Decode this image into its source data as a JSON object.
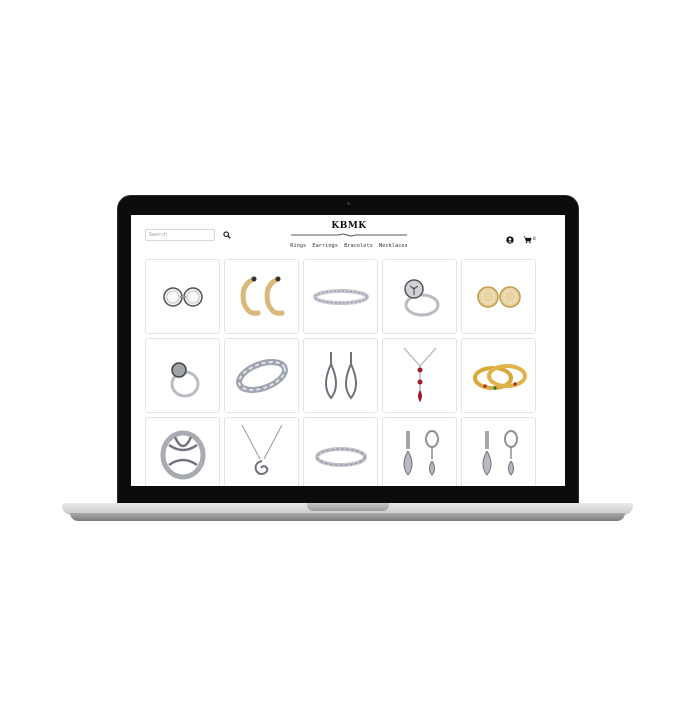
{
  "header": {
    "search_placeholder": "Search",
    "logo_text": "KBMK",
    "nav": [
      "Rings",
      "Earrings",
      "Bracelets",
      "Necklaces"
    ],
    "cart_count": "0"
  },
  "products": [
    {
      "icon": "pearl-stud-earrings-icon"
    },
    {
      "icon": "gold-hook-earrings-icon"
    },
    {
      "icon": "tennis-bracelet-icon"
    },
    {
      "icon": "tree-of-life-ring-icon"
    },
    {
      "icon": "gold-cluster-stud-earrings-icon"
    },
    {
      "icon": "tree-ring-icon"
    },
    {
      "icon": "silver-bracelet-icon"
    },
    {
      "icon": "teardrop-drop-earrings-icon"
    },
    {
      "icon": "ruby-drop-necklace-icon"
    },
    {
      "icon": "gold-gem-bangles-icon"
    },
    {
      "icon": "puzzle-ring-icon"
    },
    {
      "icon": "swirl-pendant-necklace-icon"
    },
    {
      "icon": "crystal-bangle-icon"
    },
    {
      "icon": "pave-drop-earrings-icon"
    },
    {
      "icon": "pave-drop-earrings-icon"
    }
  ],
  "colors": {
    "silver": "#b9bcc2",
    "gold": "#d9a83a",
    "ruby": "#9b1f2a",
    "bezel": "#0c0c0c"
  }
}
